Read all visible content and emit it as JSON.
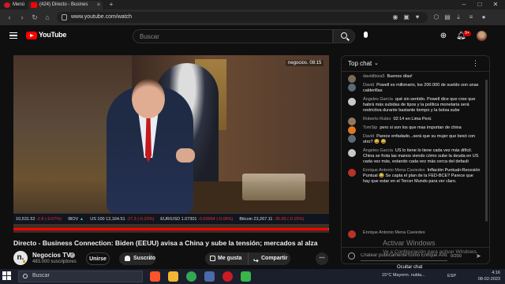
{
  "browser": {
    "tabs": [
      {
        "label": "Menú",
        "active": false
      },
      {
        "label": "(424) Directo - Busines",
        "active": true
      }
    ],
    "new_tab": "+",
    "url": "www.youtube.com/watch",
    "icons": [
      "back-icon",
      "forward-icon",
      "reload-icon",
      "lock-icon",
      "camera-icon",
      "heart-icon",
      "extensions-icon",
      "menu-icon"
    ],
    "window_controls": [
      "–",
      "□",
      "✕"
    ]
  },
  "masthead": {
    "logo_text": "YouTube",
    "logo_color": "#ff0000",
    "search_placeholder": "Buscar",
    "notification_count": "9+",
    "icons": [
      "hamburger-icon",
      "search-icon",
      "mic-icon",
      "create-icon",
      "bell-icon"
    ]
  },
  "video": {
    "watermark": "negocios. 08:15",
    "ticker": [
      {
        "name": "",
        "value": "10,531.52",
        "change": "-2.8 (-0.07%)",
        "direction": "down"
      },
      {
        "name": "IBOV",
        "value": "",
        "change": "▲",
        "direction": "up"
      },
      {
        "name": "US 100",
        "value": "12,164.51",
        "change": "-27.3 (-0.23%)",
        "direction": "down"
      },
      {
        "name": "EUR/USD",
        "value": "1.07301",
        "change": "-0.00064 (-0.06%)",
        "direction": "down"
      },
      {
        "name": "Bitcoin",
        "value": "23,267.11",
        "change": "-35.00 (-0.15%)",
        "direction": "down"
      }
    ],
    "progress_fraction": 0.998,
    "accent": "#ff0000"
  },
  "video_meta": {
    "title": "Directo - Business Connection: Biden (EEUU) avisa a China y sube la tensión; mercados al alza",
    "channel_name": "Negocios TV",
    "channel_avatar_letter": "n.",
    "subscribers": "483.000 suscriptores",
    "join_label": "Unirse",
    "subscribe_label": "Suscrito",
    "like_label": "Me gusta",
    "share_label": "Compartir",
    "more_label": "⋯"
  },
  "chat": {
    "header_title": "Top chat",
    "messages": [
      {
        "author": "davidibiza5",
        "text": "Buenos días!",
        "avatar_color": "#7a6a55"
      },
      {
        "author": "David",
        "text": "Powell es millonario, los 200.000 de sueldo son unas calderillas",
        "avatar_color": "#5a6a7a"
      },
      {
        "author": "Ángeles García",
        "text": "qué sin sentido. Powell dice que cree que habrá más subidas de tipos y la política monetaria será restrictiva durante bastante tiempo y la bolsa sube",
        "avatar_color": "#c9c9c9"
      },
      {
        "author": "Roberto Rubio",
        "text": "02:14 en Lima Perú",
        "avatar_color": "#8e7a64"
      },
      {
        "author": "TomSip",
        "text": "pero si son los que mas importan de china",
        "avatar_color": "#e07a1f"
      },
      {
        "author": "David",
        "text": "Parece enfadado...será que su mujer que besó con otro? 😅 😅",
        "avatar_color": "#5a6a7a"
      },
      {
        "author": "Ángeles García",
        "text": "US lo tiene lo tiene cada vez más difícil. China se frota las manos viendo cómo sube la deuda en US cada vez más, estando cada vez más cerca del default",
        "avatar_color": "#c9c9c9"
      },
      {
        "author": "Enrique Antonio Mena Caviedes",
        "text": "Inflación Puntual+Recesión Puntual 😂 Se capta el plan de la FED-BCE? Parece que hay que estar en el Tercer Mundo para ver claro.",
        "avatar_color": "#b8322a"
      },
      {
        "author": "Enrique Antonio Mena Caviedes",
        "text": "",
        "avatar_color": "#b8322a"
      }
    ],
    "input_placeholder": "Chatear públicamente como Enrique Antonio Mena Caviedes",
    "char_count": "0/200",
    "hide_chat_label": "Ocultar chat"
  },
  "windows_notice": {
    "title": "Activar Windows",
    "subtitle": "Ve a Configuración para activar Windows."
  },
  "taskbar": {
    "search_label": "Buscar",
    "weather": "15°C  Mayorm. nubla...",
    "lang": "ESP",
    "time": "4:16",
    "date": "08-02-2023",
    "apps": [
      {
        "name": "brave-icon",
        "color": "#fb542b"
      },
      {
        "name": "file-explorer-icon",
        "color": "#f2b632"
      },
      {
        "name": "chrome-icon",
        "color": "#34a853"
      },
      {
        "name": "task-view-icon",
        "color": "#4a6aa8"
      },
      {
        "name": "opera-icon",
        "color": "#cc1b24"
      },
      {
        "name": "app-icon",
        "color": "#39b54a"
      }
    ]
  }
}
